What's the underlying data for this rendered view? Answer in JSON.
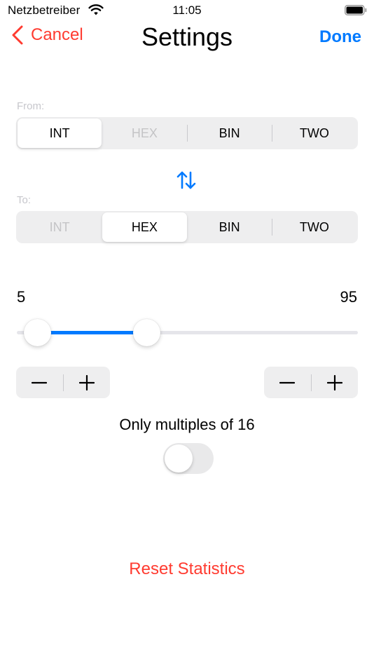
{
  "status_bar": {
    "carrier": "Netzbetreiber",
    "time": "11:05",
    "wifi_icon": "wifi-icon",
    "battery_icon": "battery-icon"
  },
  "nav": {
    "cancel_label": "Cancel",
    "title": "Settings",
    "done_label": "Done"
  },
  "from": {
    "label": "From:",
    "options": [
      {
        "label": "INT",
        "selected": true,
        "disabled": false
      },
      {
        "label": "HEX",
        "selected": false,
        "disabled": true
      },
      {
        "label": "BIN",
        "selected": false,
        "disabled": false
      },
      {
        "label": "TWO",
        "selected": false,
        "disabled": false
      }
    ]
  },
  "swap_icon": "swap-arrows-icon",
  "to": {
    "label": "To:",
    "options": [
      {
        "label": "INT",
        "selected": false,
        "disabled": true
      },
      {
        "label": "HEX",
        "selected": true,
        "disabled": false
      },
      {
        "label": "BIN",
        "selected": false,
        "disabled": false
      },
      {
        "label": "TWO",
        "selected": false,
        "disabled": false
      }
    ]
  },
  "range": {
    "min_label": "5",
    "max_label": "95",
    "lower_fraction": 0.06,
    "upper_fraction": 0.38
  },
  "steppers": {
    "minus_icon": "minus-icon",
    "plus_icon": "plus-icon"
  },
  "multiples": {
    "label": "Only multiples of 16",
    "on": false
  },
  "reset_label": "Reset Statistics",
  "colors": {
    "accent": "#007aff",
    "destructive": "#ff3b30",
    "disabled_text": "#c4c4c6"
  }
}
